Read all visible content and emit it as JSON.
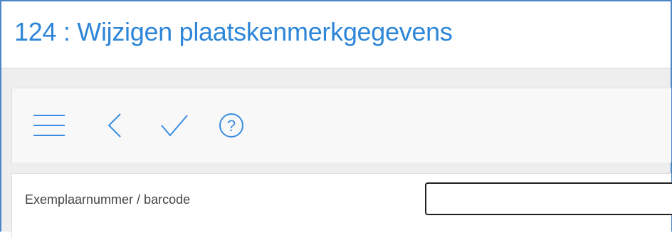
{
  "header": {
    "title": "124 : Wijzigen plaatskenmerkgegevens"
  },
  "toolbar": {
    "buttons": [
      {
        "icon": "hamburger-menu-icon",
        "label": ""
      },
      {
        "icon": "back-chevron-icon",
        "label": ""
      },
      {
        "icon": "checkmark-icon",
        "label": ""
      },
      {
        "icon": "help-icon",
        "label": "?"
      }
    ]
  },
  "form": {
    "field_label": "Exemplaarnummer / barcode",
    "field_value": ""
  },
  "colors": {
    "accent": "#2e86d8",
    "icon": "#3b8de0",
    "frame_border": "#4a86c8"
  }
}
